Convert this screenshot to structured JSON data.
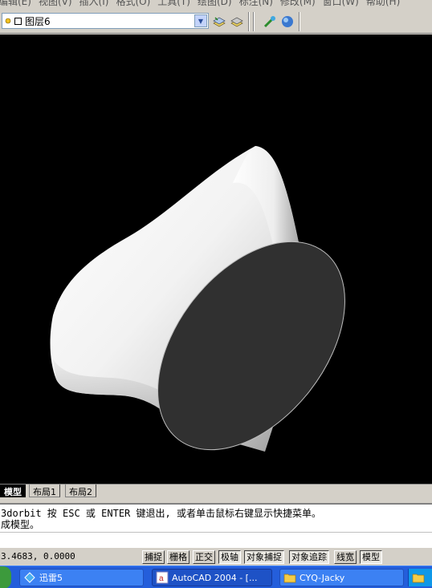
{
  "menu": {
    "items": [
      "编辑(E)",
      "视图(V)",
      "插入(I)",
      "格式(O)",
      "工具(T)",
      "绘图(D)",
      "标注(N)",
      "修改(M)",
      "窗口(W)",
      "帮助(H)"
    ]
  },
  "toolbar": {
    "layer_name": "图层6",
    "icons": [
      "layer-state-icon",
      "layer-previous-icon",
      "make-current-icon",
      "properties-icon",
      "globe-icon"
    ]
  },
  "tabs": {
    "model": "模型",
    "layout1": "布局1",
    "layout2": "布局2"
  },
  "command": {
    "line1": "3dorbit 按 ESC 或 ENTER 键退出, 或者单击鼠标右键显示快捷菜单。",
    "line2": "成模型。"
  },
  "status": {
    "coords": "3.4683, 0.0000",
    "buttons": [
      "捕捉",
      "栅格",
      "正交",
      "极轴",
      "对象捕捉",
      "对象追踪",
      "线宽",
      "模型"
    ]
  },
  "taskbar": {
    "tasks": [
      "迅雷5",
      "AutoCAD 2004 - [...",
      "CYQ-Jacky"
    ]
  },
  "colors": {
    "viewport_bg": "#000000",
    "taskbar": "#245edb",
    "chrome": "#d4d0c8"
  }
}
